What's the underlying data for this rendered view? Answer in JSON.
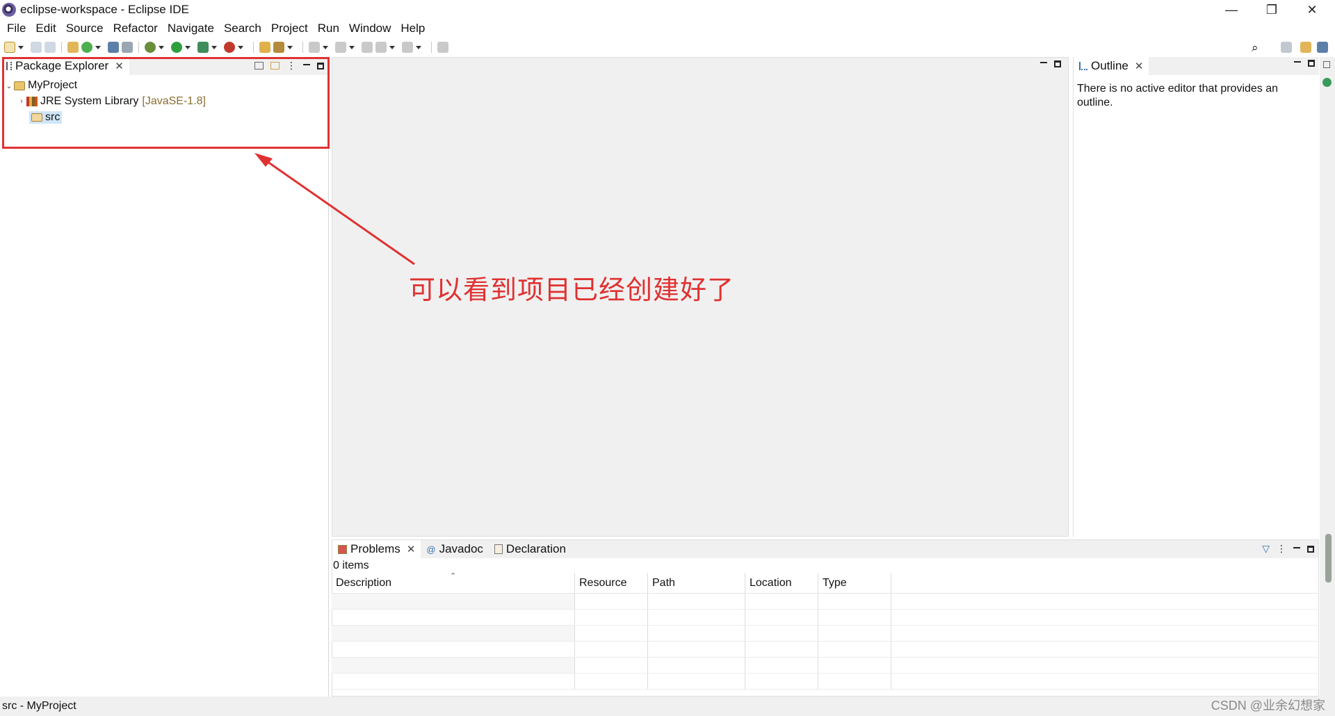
{
  "window": {
    "title": "eclipse-workspace - Eclipse IDE",
    "controls": [
      "minimize",
      "restore",
      "close"
    ],
    "minimize_glyph": "—",
    "restore_glyph": "❐",
    "close_glyph": "✕"
  },
  "menubar": {
    "items": [
      "File",
      "Edit",
      "Source",
      "Refactor",
      "Navigate",
      "Search",
      "Project",
      "Run",
      "Window",
      "Help"
    ]
  },
  "package_explorer": {
    "tab_label": "Package Explorer",
    "tree": {
      "project": "MyProject",
      "library": "JRE System Library",
      "library_decoration": "[JavaSE-1.8]",
      "src": "src"
    }
  },
  "outline": {
    "tab_label": "Outline",
    "message": "There is no active editor that provides an outline."
  },
  "annotation": {
    "text": "可以看到项目已经创建好了",
    "color": "#e03131"
  },
  "bottom_panel": {
    "tabs": [
      "Problems",
      "Javadoc",
      "Declaration"
    ],
    "item_count": "0 items",
    "columns": [
      "Description",
      "Resource",
      "Path",
      "Location",
      "Type"
    ]
  },
  "status": {
    "text": "src - MyProject"
  },
  "watermark": "CSDN @业余幻想家"
}
